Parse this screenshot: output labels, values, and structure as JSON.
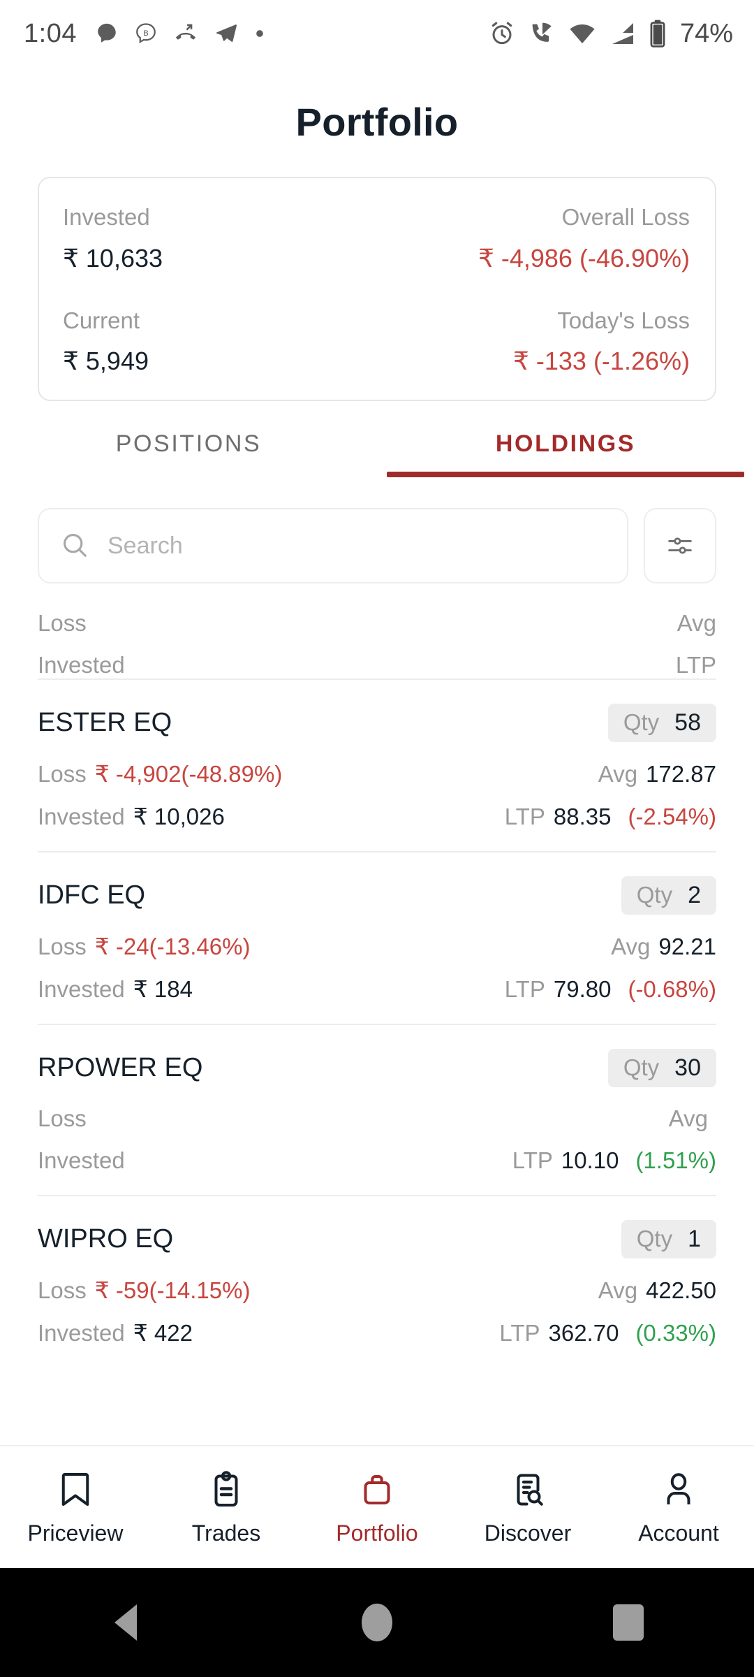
{
  "status_bar": {
    "time": "1:04",
    "battery_percent": "74%",
    "left_icons": [
      "chat-bubble-icon",
      "b-circle-icon",
      "missed-call-icon",
      "telegram-icon",
      "dot-icon"
    ],
    "right_icons": [
      "alarm-icon",
      "wifi-call-icon",
      "wifi-icon",
      "signal-icon",
      "battery-icon"
    ]
  },
  "header": {
    "title": "Portfolio"
  },
  "summary": {
    "invested_label": "Invested",
    "invested_value": "₹ 10,633",
    "overall_label": "Overall Loss",
    "overall_value": "₹ -4,986 (-46.90%)",
    "current_label": "Current",
    "current_value": "₹ 5,949",
    "today_label": "Today's Loss",
    "today_value": "₹ -133 (-1.26%)"
  },
  "tabs": [
    {
      "label": "POSITIONS",
      "active": false
    },
    {
      "label": "HOLDINGS",
      "active": true
    }
  ],
  "search": {
    "placeholder": "Search",
    "icon": "search-icon",
    "filter_icon": "sliders-icon"
  },
  "list_labels": {
    "loss": "Loss",
    "invested": "Invested",
    "avg": "Avg",
    "ltp": "LTP",
    "qty": "Qty"
  },
  "clipped_row": {
    "loss_label": "Loss",
    "avg_label": "Avg",
    "invested_label": "Invested",
    "ltp_label": "LTP"
  },
  "holdings": [
    {
      "name": "ESTER EQ",
      "qty_label": "Qty",
      "qty": "58",
      "loss_label": "Loss",
      "loss_value": "₹ -4,902(-48.89%)",
      "avg_label": "Avg",
      "avg_value": "172.87",
      "invested_label": "Invested",
      "invested_value": "₹ 10,026",
      "ltp_label": "LTP",
      "ltp_value": "88.35",
      "ltp_pct": "(-2.54%)",
      "ltp_pct_sign": "neg"
    },
    {
      "name": "IDFC EQ",
      "qty_label": "Qty",
      "qty": "2",
      "loss_label": "Loss",
      "loss_value": "₹ -24(-13.46%)",
      "avg_label": "Avg",
      "avg_value": "92.21",
      "invested_label": "Invested",
      "invested_value": "₹ 184",
      "ltp_label": "LTP",
      "ltp_value": "79.80",
      "ltp_pct": "(-0.68%)",
      "ltp_pct_sign": "neg"
    },
    {
      "name": "RPOWER EQ",
      "qty_label": "Qty",
      "qty": "30",
      "loss_label": "Loss",
      "loss_value": "",
      "avg_label": "Avg",
      "avg_value": "",
      "invested_label": "Invested",
      "invested_value": "",
      "ltp_label": "LTP",
      "ltp_value": "10.10",
      "ltp_pct": "(1.51%)",
      "ltp_pct_sign": "pos"
    },
    {
      "name": "WIPRO EQ",
      "qty_label": "Qty",
      "qty": "1",
      "loss_label": "Loss",
      "loss_value": "₹ -59(-14.15%)",
      "avg_label": "Avg",
      "avg_value": "422.50",
      "invested_label": "Invested",
      "invested_value": "₹ 422",
      "ltp_label": "LTP",
      "ltp_value": "362.70",
      "ltp_pct": "(0.33%)",
      "ltp_pct_sign": "pos"
    }
  ],
  "bottom_nav": [
    {
      "label": "Priceview",
      "icon": "bookmark-icon",
      "active": false
    },
    {
      "label": "Trades",
      "icon": "clipboard-icon",
      "active": false
    },
    {
      "label": "Portfolio",
      "icon": "briefcase-icon",
      "active": true
    },
    {
      "label": "Discover",
      "icon": "document-search-icon",
      "active": false
    },
    {
      "label": "Account",
      "icon": "person-icon",
      "active": false
    }
  ],
  "android_nav": [
    {
      "icon": "back-triangle-icon"
    },
    {
      "icon": "home-circle-icon"
    },
    {
      "icon": "recents-square-icon"
    }
  ],
  "colors": {
    "loss_red": "#c8453f",
    "gain_green": "#2fa14e",
    "accent_dark_red": "#a32a2a",
    "text_dark": "#15202b",
    "text_muted": "#9a9a9a"
  }
}
